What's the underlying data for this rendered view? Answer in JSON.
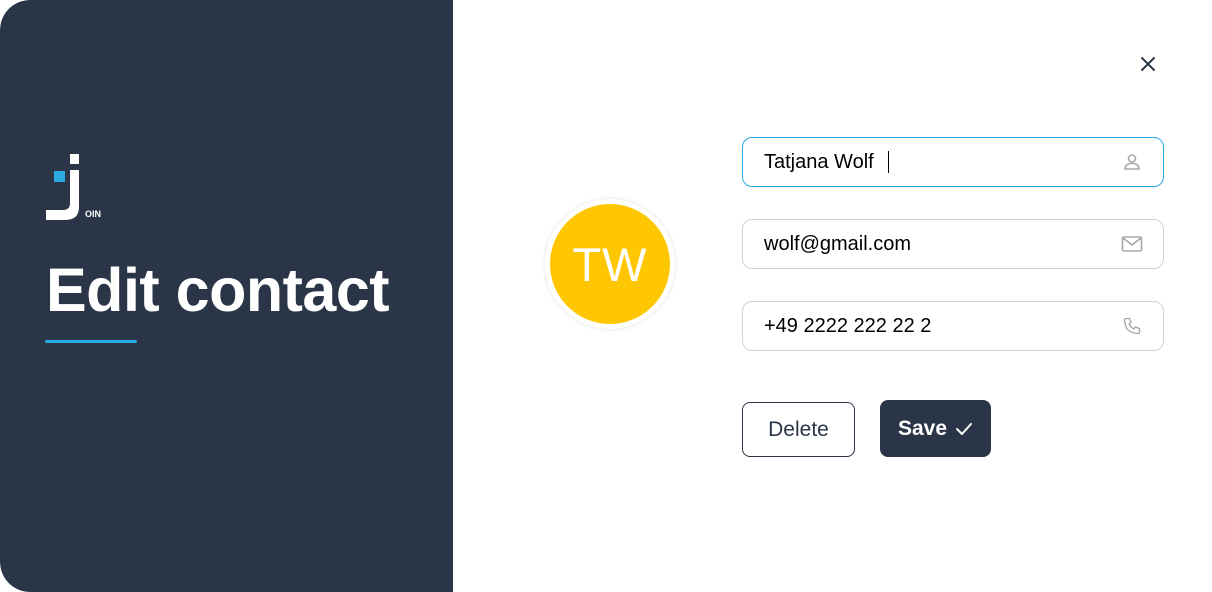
{
  "left_panel": {
    "logo_text": "OIN",
    "title": "Edit contact"
  },
  "colors": {
    "panel_bg": "#2a3647",
    "accent": "#29abe2",
    "avatar_bg": "#ffc701"
  },
  "avatar": {
    "initials": "TW"
  },
  "form": {
    "name": {
      "value": "Tatjana Wolf",
      "icon": "person-icon"
    },
    "email": {
      "value": "wolf@gmail.com",
      "icon": "mail-icon"
    },
    "phone": {
      "value": "+49 2222 222 22 2",
      "icon": "phone-icon"
    }
  },
  "buttons": {
    "delete_label": "Delete",
    "save_label": "Save",
    "close_icon": "close-icon",
    "save_icon": "check-icon"
  }
}
